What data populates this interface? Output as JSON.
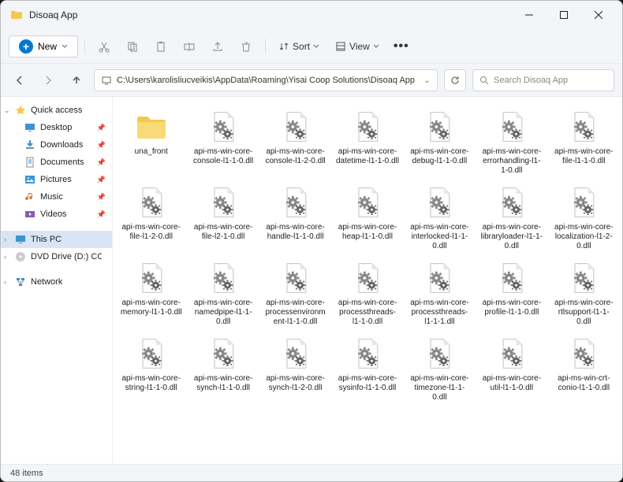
{
  "window": {
    "title": "Disoaq App"
  },
  "toolbar": {
    "new": "New",
    "sort": "Sort",
    "view": "View"
  },
  "address": {
    "path": "C:\\Users\\karolisliucveikis\\AppData\\Roaming\\Yisai Coop Solutions\\Disoaq App",
    "search_placeholder": "Search Disoaq App"
  },
  "sidebar": {
    "quick": "Quick access",
    "desktop": "Desktop",
    "downloads": "Downloads",
    "documents": "Documents",
    "pictures": "Pictures",
    "music": "Music",
    "videos": "Videos",
    "thispc": "This PC",
    "dvd": "DVD Drive (D:) CCCC",
    "network": "Network"
  },
  "files": [
    {
      "name": "una_front",
      "type": "folder"
    },
    {
      "name": "api-ms-win-core-console-l1-1-0.dll",
      "type": "dll"
    },
    {
      "name": "api-ms-win-core-console-l1-2-0.dll",
      "type": "dll"
    },
    {
      "name": "api-ms-win-core-datetime-l1-1-0.dll",
      "type": "dll"
    },
    {
      "name": "api-ms-win-core-debug-l1-1-0.dll",
      "type": "dll"
    },
    {
      "name": "api-ms-win-core-errorhandling-l1-1-0.dll",
      "type": "dll"
    },
    {
      "name": "api-ms-win-core-file-l1-1-0.dll",
      "type": "dll"
    },
    {
      "name": "api-ms-win-core-file-l1-2-0.dll",
      "type": "dll"
    },
    {
      "name": "api-ms-win-core-file-l2-1-0.dll",
      "type": "dll"
    },
    {
      "name": "api-ms-win-core-handle-l1-1-0.dll",
      "type": "dll"
    },
    {
      "name": "api-ms-win-core-heap-l1-1-0.dll",
      "type": "dll"
    },
    {
      "name": "api-ms-win-core-interlocked-l1-1-0.dll",
      "type": "dll"
    },
    {
      "name": "api-ms-win-core-libraryloader-l1-1-0.dll",
      "type": "dll"
    },
    {
      "name": "api-ms-win-core-localization-l1-2-0.dll",
      "type": "dll"
    },
    {
      "name": "api-ms-win-core-memory-l1-1-0.dll",
      "type": "dll"
    },
    {
      "name": "api-ms-win-core-namedpipe-l1-1-0.dll",
      "type": "dll"
    },
    {
      "name": "api-ms-win-core-processenvironment-l1-1-0.dll",
      "type": "dll"
    },
    {
      "name": "api-ms-win-core-processthreads-l1-1-0.dll",
      "type": "dll"
    },
    {
      "name": "api-ms-win-core-processthreads-l1-1-1.dll",
      "type": "dll"
    },
    {
      "name": "api-ms-win-core-profile-l1-1-0.dll",
      "type": "dll"
    },
    {
      "name": "api-ms-win-core-rtlsupport-l1-1-0.dll",
      "type": "dll"
    },
    {
      "name": "api-ms-win-core-string-l1-1-0.dll",
      "type": "dll"
    },
    {
      "name": "api-ms-win-core-synch-l1-1-0.dll",
      "type": "dll"
    },
    {
      "name": "api-ms-win-core-synch-l1-2-0.dll",
      "type": "dll"
    },
    {
      "name": "api-ms-win-core-sysinfo-l1-1-0.dll",
      "type": "dll"
    },
    {
      "name": "api-ms-win-core-timezone-l1-1-0.dll",
      "type": "dll"
    },
    {
      "name": "api-ms-win-core-util-l1-1-0.dll",
      "type": "dll"
    },
    {
      "name": "api-ms-win-crt-conio-l1-1-0.dll",
      "type": "dll"
    }
  ],
  "status": {
    "count": "48 items"
  }
}
